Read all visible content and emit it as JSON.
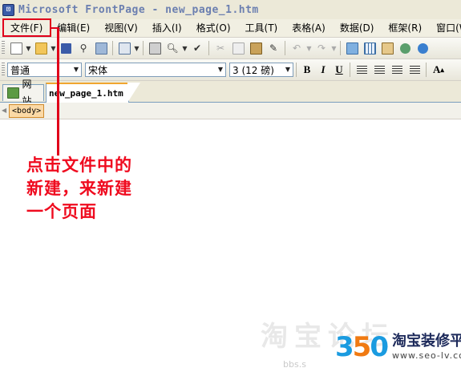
{
  "window": {
    "title": "Microsoft FrontPage - new_page_1.htm",
    "app_icon": "frontpage-icon"
  },
  "menubar": {
    "items": [
      "文件(F)",
      "编辑(E)",
      "视图(V)",
      "插入(I)",
      "格式(O)",
      "工具(T)",
      "表格(A)",
      "数据(D)",
      "框架(R)",
      "窗口(W)"
    ]
  },
  "toolbar_standard": {
    "icons": [
      "new-page-icon",
      "open-folder-icon",
      "save-icon",
      "search-icon",
      "publish-icon",
      "web-component-icon",
      "print-icon",
      "print-preview-icon",
      "spelling-icon",
      "cut-icon",
      "copy-icon",
      "paste-icon",
      "format-painter-icon",
      "undo-icon",
      "redo-icon",
      "insert-picture-icon",
      "insert-table-icon",
      "layers-icon",
      "drawing-icon",
      "hyperlink-icon"
    ]
  },
  "toolbar_formatting": {
    "style_value": "普通",
    "font_value": "宋体",
    "size_value": "3 (12 磅)",
    "bold": "B",
    "italic": "I",
    "underline": "U",
    "grow_font": "A"
  },
  "tabs": {
    "site": "网站",
    "page": "new_page_1.htm"
  },
  "tag_selector": {
    "body_tag": "<body>"
  },
  "annotation": {
    "text": "点击文件中的新建，来新建一个页面",
    "color": "#ef0b1f"
  },
  "watermark": {
    "faint": "淘宝论坛",
    "number": "3",
    "number_mid": "5",
    "number_end": "0",
    "brand": "淘宝装修平台",
    "url": "www.seo-lv.com",
    "bbs": "bbs.s",
    "colors": {
      "blue": "#1a9be0",
      "orange": "#f07a12",
      "navy": "#1d2a5b"
    }
  }
}
